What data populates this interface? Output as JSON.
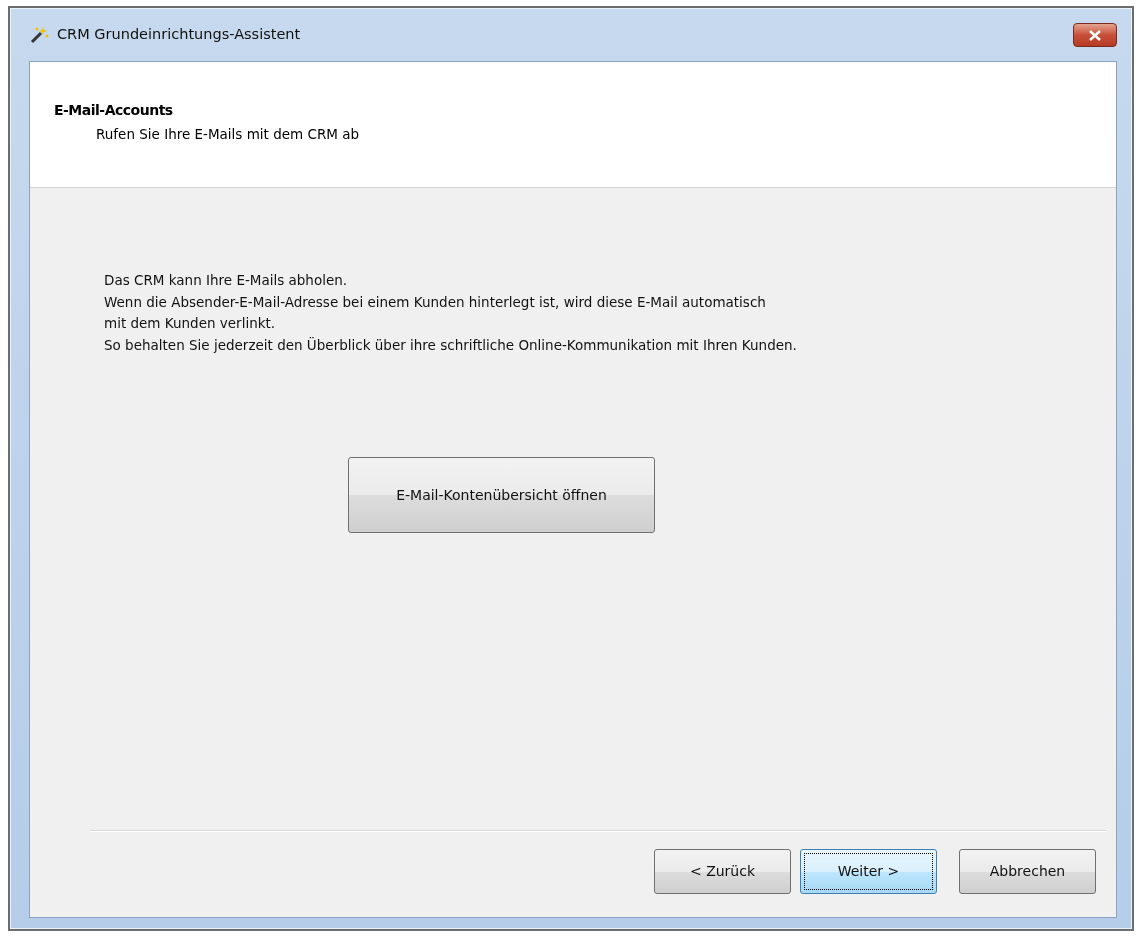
{
  "window": {
    "title": "CRM Grundeinrichtungs-Assistent"
  },
  "header": {
    "title": "E-Mail-Accounts",
    "subtitle": "Rufen Sie Ihre E-Mails mit dem CRM ab"
  },
  "description": [
    "Das CRM kann Ihre E-Mails abholen.",
    "Wenn die Absender-E-Mail-Adresse bei einem Kunden hinterlegt ist, wird diese E-Mail automatisch",
    "mit dem Kunden verlinkt.",
    "So behalten Sie jederzeit den Überblick über ihre schriftliche Online-Kommunikation mit Ihren Kunden."
  ],
  "action_button": {
    "label": "E-Mail-Kontenübersicht öffnen"
  },
  "buttons": [
    {
      "label": "< Zurück",
      "focused": false
    },
    {
      "label": "Weiter >",
      "focused": true
    },
    {
      "label": "Abbrechen",
      "focused": false
    }
  ]
}
